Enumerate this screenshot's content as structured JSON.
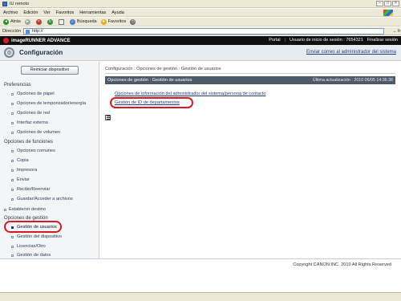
{
  "window": {
    "title": "IU remoto"
  },
  "menubar": {
    "items": [
      "Archivo",
      "Edición",
      "Ver",
      "Favoritos",
      "Herramientas",
      "Ayuda"
    ]
  },
  "toolbar": {
    "back": "Atrás",
    "search": "Búsqueda",
    "favorites": "Favoritos"
  },
  "addressbar": {
    "label": "Dirección",
    "url": "http://",
    "go": "Ir"
  },
  "appheader": {
    "brand": "imageRUNNER ADVANCE",
    "portal": "Portal",
    "user_info": "Usuario de inicio de sesión : 7654321",
    "logout": "Finalizar sesión"
  },
  "config": {
    "title": "Configuración",
    "mail_link": "Enviar correo al administrador del sistema"
  },
  "sidebar": {
    "restart": "Reiniciar dispositivo",
    "preferences_title": "Preferencias",
    "preferences": [
      "Opciones de papel",
      "Opciones de temporizador/energía",
      "Opciones de red",
      "Interfaz externa",
      "Opciones de volumen"
    ],
    "functions_title": "Opciones de funciones",
    "functions": [
      "Opciones comunes",
      "Copia",
      "Impresora",
      "Enviar",
      "Recibir/Reenviar",
      "Guardar/Acceder a archivos"
    ],
    "establish_dest": "Establecer destino",
    "management_title": "Opciones de gestión",
    "management": [
      "Gestión de usuarios",
      "Gestión del dispositivo",
      "Licencias/Otro",
      "Gestión de datos"
    ]
  },
  "main": {
    "breadcrumb": "Configuración : Opciones de gestión : Gestión de usuarios",
    "section_title": "Opciones de gestión : Gestión de usuarios",
    "last_update": "Última actualización : 2010 06/05 14:36:38",
    "links": [
      "Opciones de información del administrador del sistema/persona de contacto",
      "Gestión de ID de departamentos"
    ]
  },
  "footer": {
    "copyright": "Copyright CANON INC. 2010 All Rights Reserved"
  },
  "colors": {
    "accent_red": "#d9191f",
    "header_dark": "#101010",
    "link_blue": "#1f3a78",
    "section_bar": "#4d5a68"
  }
}
